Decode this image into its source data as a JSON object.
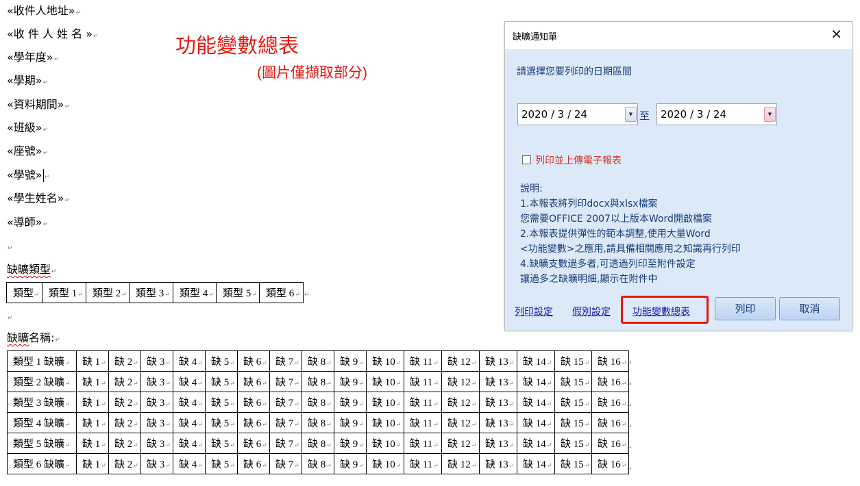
{
  "document": {
    "fields": [
      "«收件人地址»",
      "«收 件 人 姓 名 »",
      "«學年度»",
      "«學期»",
      "«資料期間»",
      "«班級»",
      "«座號»",
      "«學號»",
      "«學生姓名»",
      "«導師»"
    ],
    "paragraph_mark": "↵",
    "absence_types_heading": "缺曠類型",
    "types_table": [
      "類型",
      "類型 1",
      "類型 2",
      "類型 3",
      "類型 4",
      "類型 5",
      "類型 6"
    ],
    "absence_names_heading": "缺曠名稱:",
    "names_table": {
      "row_labels": [
        "類型 1 缺曠",
        "類型 2 缺曠",
        "類型 3 缺曠",
        "類型 4 缺曠",
        "類型 5 缺曠",
        "類型 6 缺曠"
      ],
      "columns": [
        "缺 1",
        "缺 2",
        "缺 3",
        "缺 4",
        "缺 5",
        "缺 6",
        "缺 7",
        "缺 8",
        "缺 9",
        "缺 10",
        "缺 11",
        "缺 12",
        "缺 13",
        "缺 14",
        "缺 15",
        "缺 16"
      ]
    }
  },
  "annotation": {
    "title": "功能變數總表",
    "subtitle": "(圖片僅擷取部分)",
    "color": "#e8160f"
  },
  "dialog": {
    "title": "缺曠通知單",
    "close": "✕",
    "prompt": "請選擇您要列印的日期區間",
    "start_date": "2020 / 3 / 24",
    "end_date": "2020 / 3 / 24",
    "to_label": "至",
    "checkbox_label": "列印並上傳電子報表",
    "notes": [
      "說明:",
      "1.本報表將列印docx與xlsx檔案",
      "您需要OFFICE 2007以上版本Word開啟檔案",
      "2.本報表提供彈性的範本調整,使用大量Word",
      "<功能變數>之應用,請具備相關應用之知識再行列印",
      "4.缺曠支數過多者,可透過列印至附件設定",
      "讓過多之缺曠明細,顯示在附件中"
    ],
    "links": {
      "print_settings": "列印設定",
      "leave_settings": "假別設定",
      "field_summary": "功能變數總表"
    },
    "buttons": {
      "print": "列印",
      "cancel": "取消"
    },
    "colors": {
      "body": "#dce9f8",
      "highlight": "#e8160f",
      "link": "#1a1aa6"
    }
  }
}
